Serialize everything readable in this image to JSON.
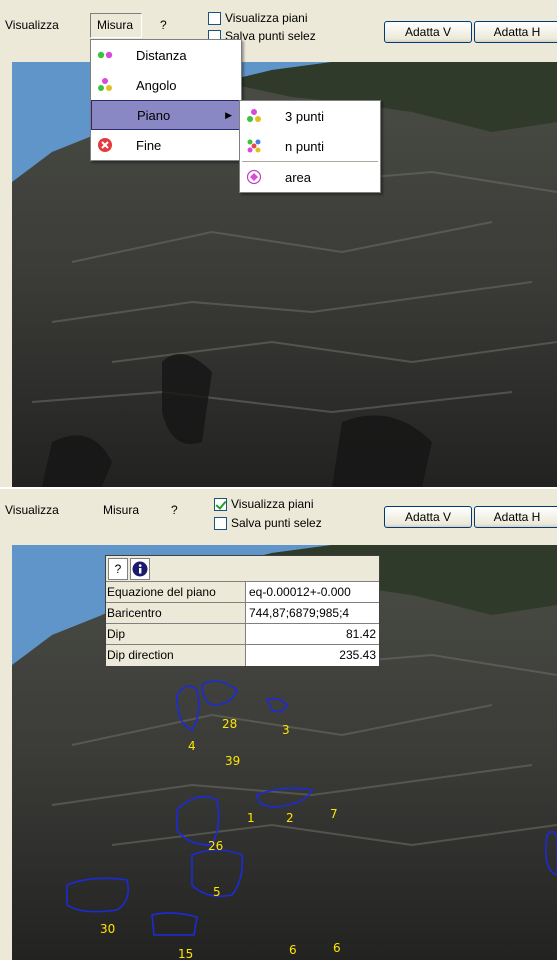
{
  "top": {
    "menu": {
      "visualizza": "Visualizza",
      "misura": "Misura",
      "help": "?"
    },
    "checks": {
      "visualizza_piani": "Visualizza piani",
      "salva_punti": "Salva punti selez"
    },
    "buttons": {
      "adatta_v": "Adatta V",
      "adatta_h": "Adatta H"
    },
    "misura_menu": {
      "items": [
        {
          "label": "Distanza",
          "icon": "two-dots-green-pink-icon"
        },
        {
          "label": "Angolo",
          "icon": "three-dots-angle-icon"
        },
        {
          "label": "Piano",
          "icon": "none",
          "highlighted": true
        },
        {
          "label": "Fine",
          "icon": "red-cross-circle-icon"
        }
      ]
    },
    "piano_submenu": {
      "items": [
        {
          "label": "3 punti",
          "icon": "three-dots-icon"
        },
        {
          "label": "n punti",
          "icon": "multi-dots-icon"
        },
        {
          "label": "area",
          "icon": "area-circle-icon"
        }
      ]
    }
  },
  "bottom": {
    "menu": {
      "visualizza": "Visualizza",
      "misura": "Misura",
      "help": "?"
    },
    "checks": {
      "visualizza_piani": "Visualizza piani",
      "visualizza_checked": true,
      "salva_punti": "Salva punti selez"
    },
    "buttons": {
      "adatta_v": "Adatta V",
      "adatta_h": "Adatta H"
    },
    "info": {
      "help_button": "?",
      "info_icon": "info-icon",
      "rows": [
        {
          "key": "Equazione del piano",
          "value": "eq-0.00012+-0.000"
        },
        {
          "key": "Baricentro",
          "value": "744,87;6879;985;4"
        },
        {
          "key": "Dip",
          "value": "81.42"
        },
        {
          "key": "Dip direction",
          "value": "235.43"
        }
      ]
    },
    "markers": [
      "28",
      "3",
      "4",
      "39",
      "1",
      "2",
      "7",
      "26",
      "5",
      "30",
      "15",
      "6",
      "6"
    ],
    "colors": {
      "marker": "#ffe600",
      "outline": "#1c2bd8"
    }
  }
}
